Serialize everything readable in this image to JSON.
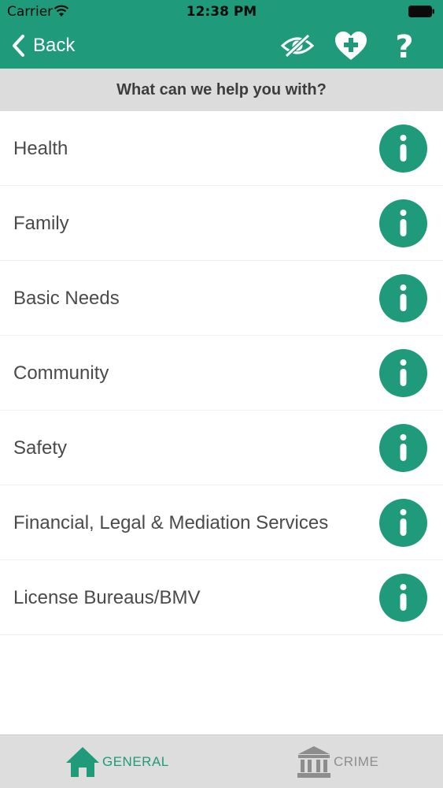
{
  "status_bar": {
    "carrier": "Carrier",
    "time": "12:38 PM"
  },
  "nav": {
    "back_label": "Back",
    "icons": [
      "eye-slash-icon",
      "heart-plus-icon",
      "question-icon"
    ]
  },
  "header": {
    "title": "What can we help you with?"
  },
  "categories": [
    {
      "label": "Health",
      "icon": "info-icon"
    },
    {
      "label": "Family",
      "icon": "info-icon"
    },
    {
      "label": "Basic Needs",
      "icon": "info-icon"
    },
    {
      "label": "Community",
      "icon": "info-icon"
    },
    {
      "label": "Safety",
      "icon": "info-icon"
    },
    {
      "label": "Financial, Legal & Mediation Services",
      "icon": "info-icon"
    },
    {
      "label": "License Bureaus/BMV",
      "icon": "info-icon"
    }
  ],
  "tabs": [
    {
      "label": "GENERAL",
      "icon": "home-icon",
      "selected": true
    },
    {
      "label": "CRIME",
      "icon": "courthouse-icon",
      "selected": false
    }
  ],
  "colors": {
    "accent": "#1f9a7a",
    "header_bg": "#dcdcdc",
    "tab_bar_bg": "#dddddd",
    "inactive_tab": "#8d8d8d"
  }
}
